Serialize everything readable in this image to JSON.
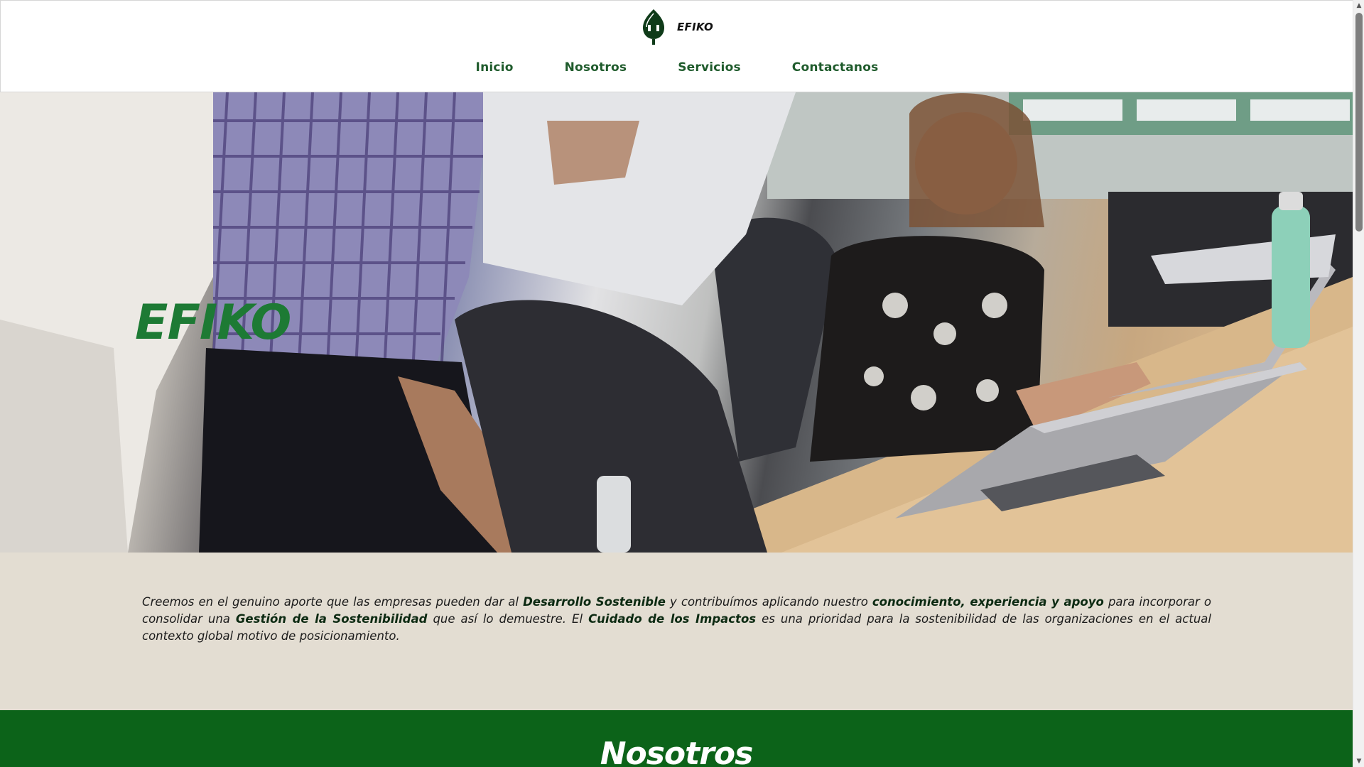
{
  "brand": {
    "name": "EFIKO",
    "logo_icon": "plug-leaf-icon",
    "color": "#0f3b19"
  },
  "nav": {
    "items": [
      {
        "label": "Inicio"
      },
      {
        "label": "Nosotros"
      },
      {
        "label": "Servicios"
      },
      {
        "label": "Contactanos"
      }
    ]
  },
  "hero": {
    "title": "EFIKO",
    "title_color": "#1d7a34",
    "image_description_icon": "office-team-photo"
  },
  "intro": {
    "segments": [
      {
        "text": "Creemos en el genuino aporte que las empresas pueden dar al ",
        "bold": false
      },
      {
        "text": "Desarrollo Sostenible",
        "bold": true
      },
      {
        "text": " y contribuímos aplicando nuestro ",
        "bold": false
      },
      {
        "text": "conocimiento, experiencia y apoyo",
        "bold": true
      },
      {
        "text": " para incorporar o consolidar una ",
        "bold": false
      },
      {
        "text": "Gestión de la Sostenibilidad",
        "bold": true
      },
      {
        "text": " que así lo demuestre. El ",
        "bold": false
      },
      {
        "text": "Cuidado de los Impactos",
        "bold": true
      },
      {
        "text": " es una prioridad para la sostenibilidad de las organizaciones en el actual contexto global motivo de posicionamiento.",
        "bold": false
      }
    ],
    "background": "#e3ddd2"
  },
  "section_nosotros": {
    "title": "Nosotros",
    "background": "#0c6319"
  },
  "scrollbar": {
    "up_icon": "scroll-up-arrow-icon",
    "down_icon": "scroll-down-arrow-icon"
  }
}
